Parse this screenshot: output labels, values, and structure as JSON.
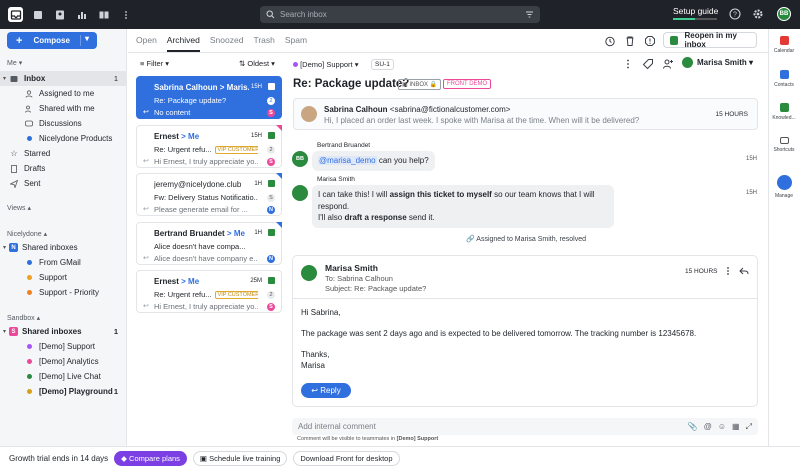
{
  "topbar": {
    "search_placeholder": "Search inbox",
    "setup_label": "Setup guide",
    "setup_progress": 0.5,
    "avatar_initials": "BB"
  },
  "sidebar": {
    "compose_label": "Compose",
    "me_label": "Me",
    "me_items": [
      {
        "label": "Inbox",
        "count": "1"
      },
      {
        "label": "Assigned to me",
        "count": ""
      },
      {
        "label": "Shared with me",
        "count": ""
      },
      {
        "label": "Discussions",
        "count": ""
      },
      {
        "label": "Nicelydone Products",
        "count": ""
      },
      {
        "label": "Starred",
        "count": ""
      },
      {
        "label": "Drafts",
        "count": ""
      },
      {
        "label": "Sent",
        "count": ""
      }
    ],
    "views_label": "Views",
    "nicelydone_label": "Nicelydone",
    "shared_inboxes_label": "Shared inboxes",
    "nicelydone_items": [
      "From GMail",
      "Support",
      "Support - Priority"
    ],
    "sandbox_label": "Sandbox",
    "sandbox_shared_label": "Shared inboxes",
    "sandbox_count": "1",
    "sandbox_items": [
      {
        "label": "[Demo] Support",
        "count": ""
      },
      {
        "label": "[Demo] Analytics",
        "count": ""
      },
      {
        "label": "[Demo] Live Chat",
        "count": ""
      },
      {
        "label": "[Demo] Playground",
        "count": "1"
      }
    ]
  },
  "bottom": {
    "trial": "Growth trial ends in 14 days",
    "compare": "Compare plans",
    "schedule": "Schedule live training",
    "download": "Download Front for desktop"
  },
  "tabs": [
    "Open",
    "Archived",
    "Snoozed",
    "Trash",
    "Spam"
  ],
  "list": {
    "filter_label": "Filter",
    "sort_label": "Oldest",
    "cards": [
      {
        "from": "Sabrina Calhoun > Maris...",
        "time": "15H",
        "subject": "Re: Package update?",
        "preview": "No content",
        "count": "2",
        "initial": "S"
      },
      {
        "from": "Ernest",
        "to": "> Me",
        "time": "15H",
        "subject": "Re: Urgent refu...",
        "vip": "VIP CUSTOMERS",
        "preview": "Hi Ernest, I truly appreciate yo...",
        "count": "2",
        "initial": "S"
      },
      {
        "from": "jeremy@nicelydone.club",
        "time": "1H",
        "subject": "Fw: Delivery Status Notificatio...",
        "preview": "Please generate email for ...",
        "count": "S",
        "initial": "N"
      },
      {
        "from": "Bertrand Bruandet",
        "to": "> Me",
        "time": "1H",
        "subject": "Alice doesn't have compa...",
        "preview": "Alice doesn't have company e...",
        "count": "",
        "initial": "N"
      },
      {
        "from": "Ernest",
        "to": "> Me",
        "time": "25M",
        "subject": "Re: Urgent refu...",
        "vip": "VIP CUSTOMERS",
        "preview": "Hi Ernest, I truly appreciate yo...",
        "count": "2",
        "initial": "S"
      }
    ]
  },
  "conversation": {
    "inbox": "[Demo] Support",
    "ticket": "SU-1",
    "title": "Re: Package update?",
    "tag_inbox": "INBOX",
    "tag_front": "FRONT DEMO",
    "reopen_label": "Reopen in my inbox",
    "assignee": "Marisa Smith",
    "msg1": {
      "name": "Sabrina Calhoun",
      "email": "<sabrina@fictionalcustomer.com>",
      "body": "Hi, I placed an order last week. I spoke with Marisa at the time. When will it be delivered?",
      "time": "15 HOURS"
    },
    "comment1": {
      "author": "Bertrand Bruandet",
      "mention": "@marisa_demo",
      "text": "can you help?",
      "time": "15H",
      "avatar": "BB"
    },
    "comment2": {
      "author": "Marisa Smith",
      "line1a": "I can take this! I will ",
      "line1b": "assign this ticket to myself",
      "line1c": " so our team knows that I will",
      "line2": "respond.",
      "line3a": "I'll also ",
      "line3b": "draft a response",
      "line3c": " send it.",
      "time": "15H"
    },
    "assigned_note": "Assigned to Marisa Smith, resolved",
    "msg2": {
      "name": "Marisa Smith",
      "to": "To: Sabrina Calhoun",
      "subject": "Subject: Re: Package update?",
      "time": "15 HOURS",
      "p1": "Hi Sabrina,",
      "p2": "The package was sent 2 days ago and is expected to be delivered tomorrow. The tracking number is 12345678.",
      "p3a": "Thanks,",
      "p3b": "Marisa",
      "reply": "Reply"
    },
    "comment_placeholder": "Add internal comment",
    "comment_note_a": "Comment will be visible to teammates in ",
    "comment_note_b": "[Demo] Support"
  },
  "rail": [
    "Calendar",
    "Contacts",
    "Knowled...",
    "Shortcuts",
    "Manage"
  ]
}
